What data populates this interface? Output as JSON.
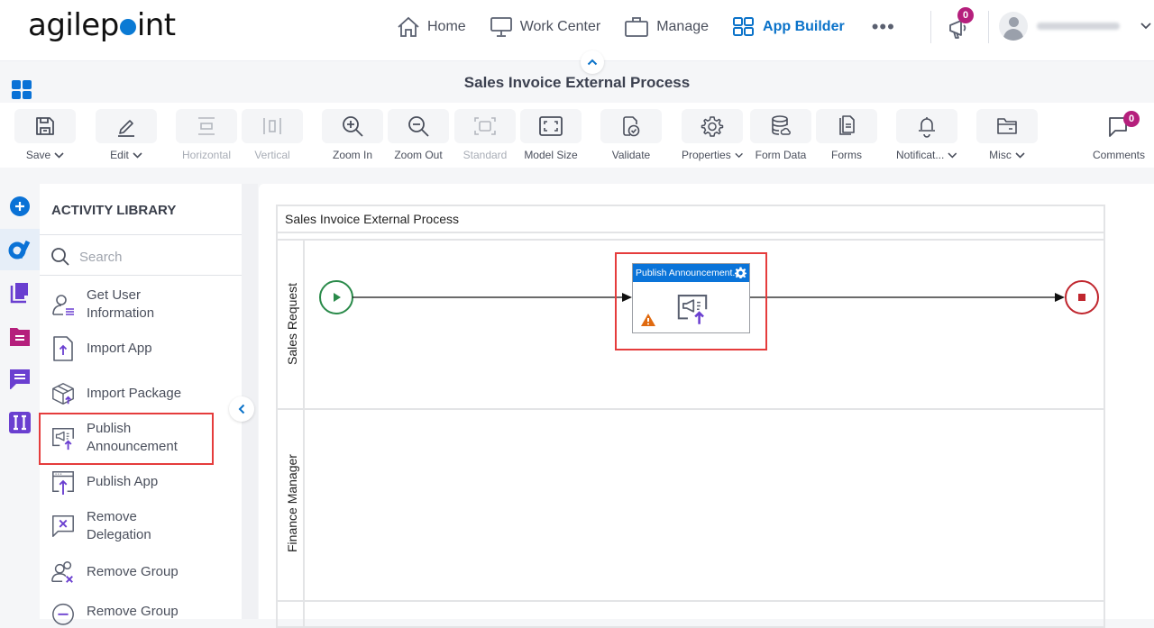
{
  "brand": {
    "logo_text_before": "agilep",
    "logo_text_after": "int",
    "accent": "#0a72d6"
  },
  "topnav": {
    "items": [
      {
        "label": "Home",
        "icon": "home-icon",
        "active": false
      },
      {
        "label": "Work Center",
        "icon": "monitor-icon",
        "active": false
      },
      {
        "label": "Manage",
        "icon": "briefcase-icon",
        "active": false
      },
      {
        "label": "App Builder",
        "icon": "grid-icon",
        "active": true
      }
    ],
    "more_label": "•••",
    "announcements_count": "0",
    "user_name": "administrator"
  },
  "page": {
    "title": "Sales Invoice External Process"
  },
  "toolbar": {
    "items": [
      {
        "label": "Save",
        "icon": "save-icon",
        "dropdown": true,
        "disabled": false
      },
      {
        "label": "Edit",
        "icon": "pencil-icon",
        "dropdown": true,
        "disabled": false
      },
      {
        "label": "Horizontal",
        "icon": "horizontal-layout-icon",
        "dropdown": false,
        "disabled": true
      },
      {
        "label": "Vertical",
        "icon": "vertical-layout-icon",
        "dropdown": false,
        "disabled": true
      },
      {
        "label": "Zoom In",
        "icon": "zoom-in-icon",
        "dropdown": false,
        "disabled": false
      },
      {
        "label": "Zoom Out",
        "icon": "zoom-out-icon",
        "dropdown": false,
        "disabled": false
      },
      {
        "label": "Standard",
        "icon": "standard-size-icon",
        "dropdown": false,
        "disabled": true
      },
      {
        "label": "Model Size",
        "icon": "model-size-icon",
        "dropdown": false,
        "disabled": false
      },
      {
        "label": "Validate",
        "icon": "validate-icon",
        "dropdown": false,
        "disabled": false
      },
      {
        "label": "Properties",
        "icon": "gear-icon",
        "dropdown": true,
        "disabled": false
      },
      {
        "label": "Form Data",
        "icon": "database-icon",
        "dropdown": false,
        "disabled": false
      },
      {
        "label": "Forms",
        "icon": "forms-icon",
        "dropdown": false,
        "disabled": false
      },
      {
        "label": "Notificat...",
        "icon": "bell-icon",
        "dropdown": true,
        "disabled": false
      },
      {
        "label": "Misc",
        "icon": "folder-icon",
        "dropdown": true,
        "disabled": false
      },
      {
        "label": "Comments",
        "icon": "comment-icon",
        "dropdown": false,
        "disabled": false,
        "badge": "0"
      }
    ]
  },
  "rail": {
    "items": [
      {
        "name": "add-activity",
        "icon": "plus-circle-icon",
        "color": "#0a72d6"
      },
      {
        "name": "agilepoint-activities",
        "icon": "agilepoint-icon",
        "color": "#0a72d6",
        "active": true
      },
      {
        "name": "documents",
        "icon": "copy-icon",
        "color": "#6a3fd0"
      },
      {
        "name": "forms",
        "icon": "folder-form-icon",
        "color": "#b51f7c"
      },
      {
        "name": "messaging",
        "icon": "chat-icon",
        "color": "#6a3fd0"
      },
      {
        "name": "integrations",
        "icon": "ii-icon",
        "color": "#6a3fd0"
      }
    ]
  },
  "library": {
    "title": "ACTIVITY LIBRARY",
    "search_placeholder": "Search",
    "items": [
      {
        "label": "Get User Information",
        "icon": "user-list-icon"
      },
      {
        "label": "Import App",
        "icon": "import-file-icon"
      },
      {
        "label": "Import Package",
        "icon": "package-icon"
      },
      {
        "label": "Publish Announcement",
        "icon": "announcement-icon",
        "highlighted": true
      },
      {
        "label": "Publish App",
        "icon": "publish-app-icon"
      },
      {
        "label": "Remove Delegation",
        "icon": "remove-delegation-icon"
      },
      {
        "label": "Remove Group",
        "icon": "remove-group-icon"
      },
      {
        "label": "Remove Group",
        "icon": "remove-circle-icon"
      }
    ]
  },
  "process": {
    "pool_title": "Sales Invoice External Process",
    "lanes": [
      {
        "label": "Sales Request"
      },
      {
        "label": "Finance Manager"
      }
    ],
    "activity": {
      "title": "Publish Announcement...",
      "warning": true,
      "highlighted": true
    },
    "start_event_color": "#2a8a4a",
    "end_event_color": "#c0262e"
  }
}
